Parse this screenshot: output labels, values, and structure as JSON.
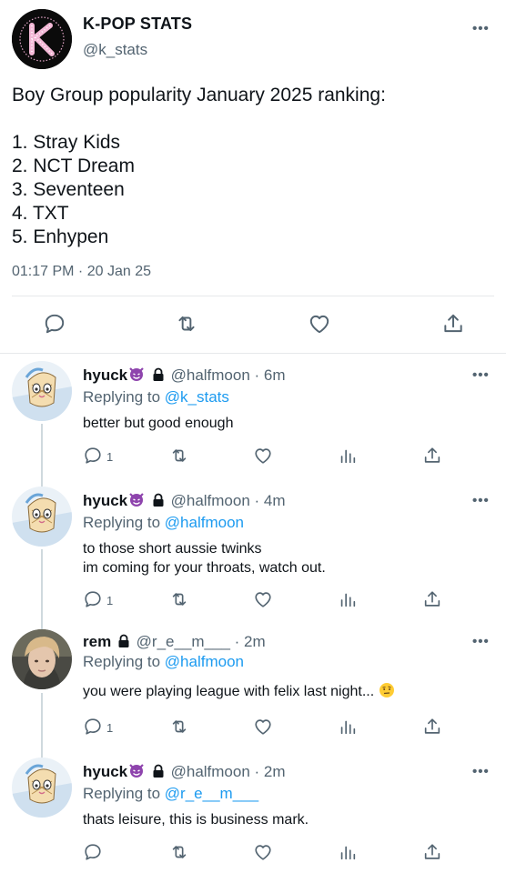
{
  "main": {
    "name": "K-POP STATS",
    "handle": "@k_stats",
    "text_lines": [
      "Boy Group popularity January 2025 ranking:",
      "",
      "1. Stray Kids",
      "2. NCT Dream",
      "3. Seventeen",
      "4. TXT",
      "5. Enhypen"
    ],
    "timestamp": "01:17 PM · 20 Jan 25",
    "more": "•••",
    "actions": [
      "reply-icon",
      "retweet-icon",
      "like-icon",
      "share-icon"
    ]
  },
  "replies": [
    {
      "name": "hyuck",
      "handle": "@halfmoon",
      "time": "· 6m",
      "replying_label": "Replying to",
      "replying_to": "@k_stats",
      "text_lines": [
        "better but good enough"
      ],
      "reply_count": "1",
      "more": "•••"
    },
    {
      "name": "hyuck",
      "handle": "@halfmoon",
      "time": "· 4m",
      "replying_label": "Replying to",
      "replying_to": "@halfmoon",
      "text_lines": [
        "to those short aussie twinks",
        "im coming for your throats, watch out."
      ],
      "reply_count": "1",
      "more": "•••"
    },
    {
      "name": "rem",
      "handle": "@r_e__m___",
      "time": "· 2m",
      "replying_label": "Replying to",
      "replying_to": "@halfmoon",
      "text_lines": [
        "you were playing league with felix last night..."
      ],
      "reply_count": "1",
      "more": "•••"
    },
    {
      "name": "hyuck",
      "handle": "@halfmoon",
      "time": "· 2m",
      "replying_label": "Replying to",
      "replying_to": "@r_e__m___",
      "text_lines": [
        "thats leisure, this is business mark."
      ],
      "reply_count": "",
      "more": "•••"
    }
  ],
  "colors": {
    "text": "#0f1419",
    "muted": "#536471",
    "link": "#1d9bf0",
    "devil_emoji": "#8e44ad",
    "divider": "#e6e9eb"
  }
}
